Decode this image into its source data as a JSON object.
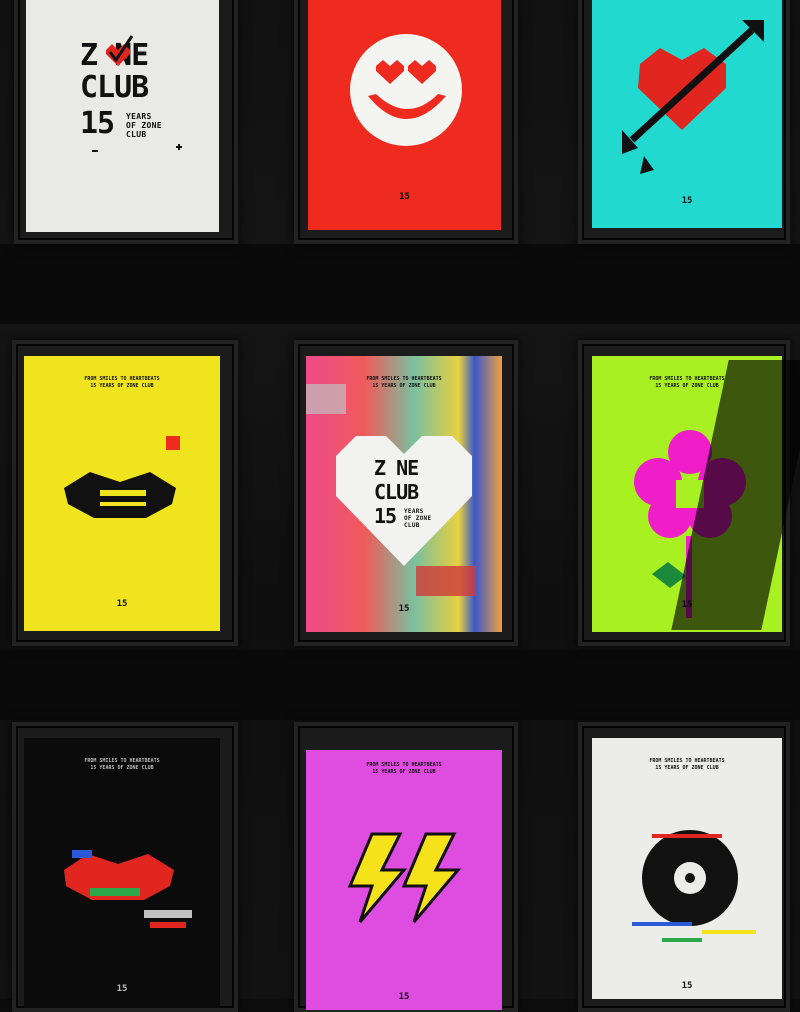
{
  "posters": {
    "p1": {
      "title_line1": "Z  NE",
      "title_line2": "CLUB",
      "number": "15",
      "subtitle_1": "YEARS",
      "subtitle_2": "OF ZONE",
      "subtitle_3": "CLUB"
    },
    "p2": {
      "footer": "15"
    },
    "p3": {
      "footer": "15"
    },
    "p4": {
      "headline_1": "FROM SMILES TO HEARTBEATS",
      "headline_2": "15 YEARS OF ZONE CLUB",
      "footer": "15"
    },
    "p5": {
      "headline_1": "FROM SMILES TO HEARTBEATS",
      "headline_2": "15 YEARS OF ZONE CLUB",
      "title_line1": "Z  NE",
      "title_line2": "CLUB",
      "number": "15",
      "subtitle_1": "YEARS",
      "subtitle_2": "OF ZONE",
      "subtitle_3": "CLUB",
      "footer": "15"
    },
    "p6": {
      "headline_1": "FROM SMILES TO HEARTBEATS",
      "headline_2": "15 YEARS OF ZONE CLUB",
      "footer": "15"
    },
    "p7": {
      "headline_1": "FROM SMILES TO HEARTBEATS",
      "headline_2": "15 YEARS OF ZONE CLUB",
      "footer": "15"
    },
    "p8": {
      "headline_1": "FROM SMILES TO HEARTBEATS",
      "headline_2": "15 YEARS OF ZONE CLUB",
      "footer": "15"
    },
    "p9": {
      "headline_1": "FROM SMILES TO HEARTBEATS",
      "headline_2": "15 YEARS OF ZONE CLUB",
      "footer": "15"
    }
  },
  "colors": {
    "p1_bg": "#e9e9e6",
    "p2_bg": "#ef2a1e",
    "p3_bg": "#21d9cf",
    "p4_bg": "#f0e41e",
    "p6_bg": "#a8f022",
    "p7_bg": "#0b0b0b",
    "p8_bg": "#df4ce0",
    "p9_bg": "#ececea",
    "heart_red": "#e0261f",
    "magenta": "#f01ec8",
    "lightning": "#f5e21a"
  }
}
